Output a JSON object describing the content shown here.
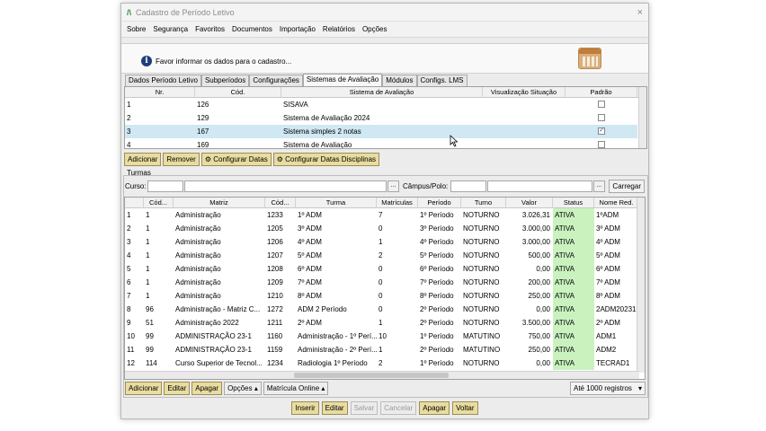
{
  "window": {
    "title": "Cadastro de Período Letivo",
    "close_glyph": "×"
  },
  "menu": [
    "Sobre",
    "Segurança",
    "Favoritos",
    "Documentos",
    "Importação",
    "Relatórios",
    "Opções"
  ],
  "info": {
    "text": "Favor informar os dados para o cadastro..."
  },
  "tabs": [
    {
      "label": "Dados Período Letivo",
      "active": false
    },
    {
      "label": "Subperíodos",
      "active": false
    },
    {
      "label": "Configurações",
      "active": false
    },
    {
      "label": "Sistemas de Avaliação",
      "active": true
    },
    {
      "label": "Módulos",
      "active": false
    },
    {
      "label": "Configs. LMS",
      "active": false
    }
  ],
  "grid1": {
    "columns": [
      "Nr.",
      "Cód.",
      "Sistema de Avaliação",
      "Visualização Situação",
      "Padrão"
    ],
    "rows": [
      {
        "nr": "1",
        "cod": "126",
        "nome": "SISAVA",
        "padrao": false
      },
      {
        "nr": "2",
        "cod": "129",
        "nome": "Sistema de Avaliação 2024",
        "padrao": false
      },
      {
        "nr": "3",
        "cod": "167",
        "nome": "Sistema simples 2 notas",
        "padrao": true,
        "selected": true
      },
      {
        "nr": "4",
        "cod": "169",
        "nome": "Sistema de Avaliação",
        "padrao": false
      }
    ]
  },
  "grid1_buttons": [
    "Adicionar",
    "Remover",
    "Configurar Datas",
    "Configurar Datas Disciplinas"
  ],
  "turmas": {
    "label": "Turmas",
    "curso_label": "Curso:",
    "campus_label": "Câmpus/Polo:",
    "dots": "...",
    "carregar": "Carregar"
  },
  "grid2": {
    "columns": [
      "",
      "Cód...",
      "Matriz",
      "Cód...",
      "Turma",
      "Matrículas",
      "Período",
      "Turno",
      "Valor",
      "Status",
      "Nome Red."
    ],
    "rows": [
      [
        "1",
        "1",
        "Administração",
        "1233",
        "1º ADM",
        "7",
        "1º Período",
        "NOTURNO",
        "3.026,31",
        "ATIVA",
        "1ºADM"
      ],
      [
        "2",
        "1",
        "Administração",
        "1205",
        "3º ADM",
        "0",
        "3º Período",
        "NOTURNO",
        "3.000,00",
        "ATIVA",
        "3º ADM"
      ],
      [
        "3",
        "1",
        "Administração",
        "1206",
        "4º ADM",
        "1",
        "4º Período",
        "NOTURNO",
        "3.000,00",
        "ATIVA",
        "4º ADM"
      ],
      [
        "4",
        "1",
        "Administração",
        "1207",
        "5º ADM",
        "2",
        "5º Período",
        "NOTURNO",
        "500,00",
        "ATIVA",
        "5º ADM"
      ],
      [
        "5",
        "1",
        "Administração",
        "1208",
        "6º ADM",
        "0",
        "6º Período",
        "NOTURNO",
        "0,00",
        "ATIVA",
        "6º ADM"
      ],
      [
        "6",
        "1",
        "Administração",
        "1209",
        "7º ADM",
        "0",
        "7º Período",
        "NOTURNO",
        "200,00",
        "ATIVA",
        "7º ADM"
      ],
      [
        "7",
        "1",
        "Administração",
        "1210",
        "8º ADM",
        "0",
        "8º Período",
        "NOTURNO",
        "250,00",
        "ATIVA",
        "8º ADM"
      ],
      [
        "8",
        "96",
        "Administração - Matriz C...",
        "1272",
        "ADM 2 Período",
        "0",
        "2º Período",
        "NOTURNO",
        "0,00",
        "ATIVA",
        "2ADM20231"
      ],
      [
        "9",
        "51",
        "Administração 2022",
        "1211",
        "2º ADM",
        "1",
        "2º Período",
        "NOTURNO",
        "3.500,00",
        "ATIVA",
        "2º ADM"
      ],
      [
        "10",
        "99",
        "ADMINISTRAÇÃO 23-1",
        "1160",
        "Administração - 1º Perí...",
        "10",
        "1º Período",
        "MATUTINO",
        "750,00",
        "ATIVA",
        "ADM1"
      ],
      [
        "11",
        "99",
        "ADMINISTRAÇÃO 23-1",
        "1159",
        "Administração - 2º Perí...",
        "1",
        "2º Período",
        "MATUTINO",
        "250,00",
        "ATIVA",
        "ADM2"
      ],
      [
        "12",
        "114",
        "Curso Superior de Tecnol...",
        "1234",
        "Radiologia 1º Período",
        "2",
        "1º Período",
        "NOTURNO",
        "0,00",
        "ATIVA",
        "TECRAD1"
      ]
    ]
  },
  "grid2_buttons": [
    "Adicionar",
    "Editar",
    "Apagar",
    "Opções",
    "Matrícula Online"
  ],
  "limit_select": "Até 1000 registros",
  "bottom_buttons": [
    {
      "label": "Inserir",
      "enabled": true
    },
    {
      "label": "Editar",
      "enabled": true
    },
    {
      "label": "Salvar",
      "enabled": false
    },
    {
      "label": "Cancelar",
      "enabled": false
    },
    {
      "label": "Apagar",
      "enabled": true
    },
    {
      "label": "Voltar",
      "enabled": true
    }
  ],
  "colors": {
    "selected_row": "#cfe8f3",
    "status_cell": "#c9f2bf",
    "button": "#e8dca0"
  }
}
